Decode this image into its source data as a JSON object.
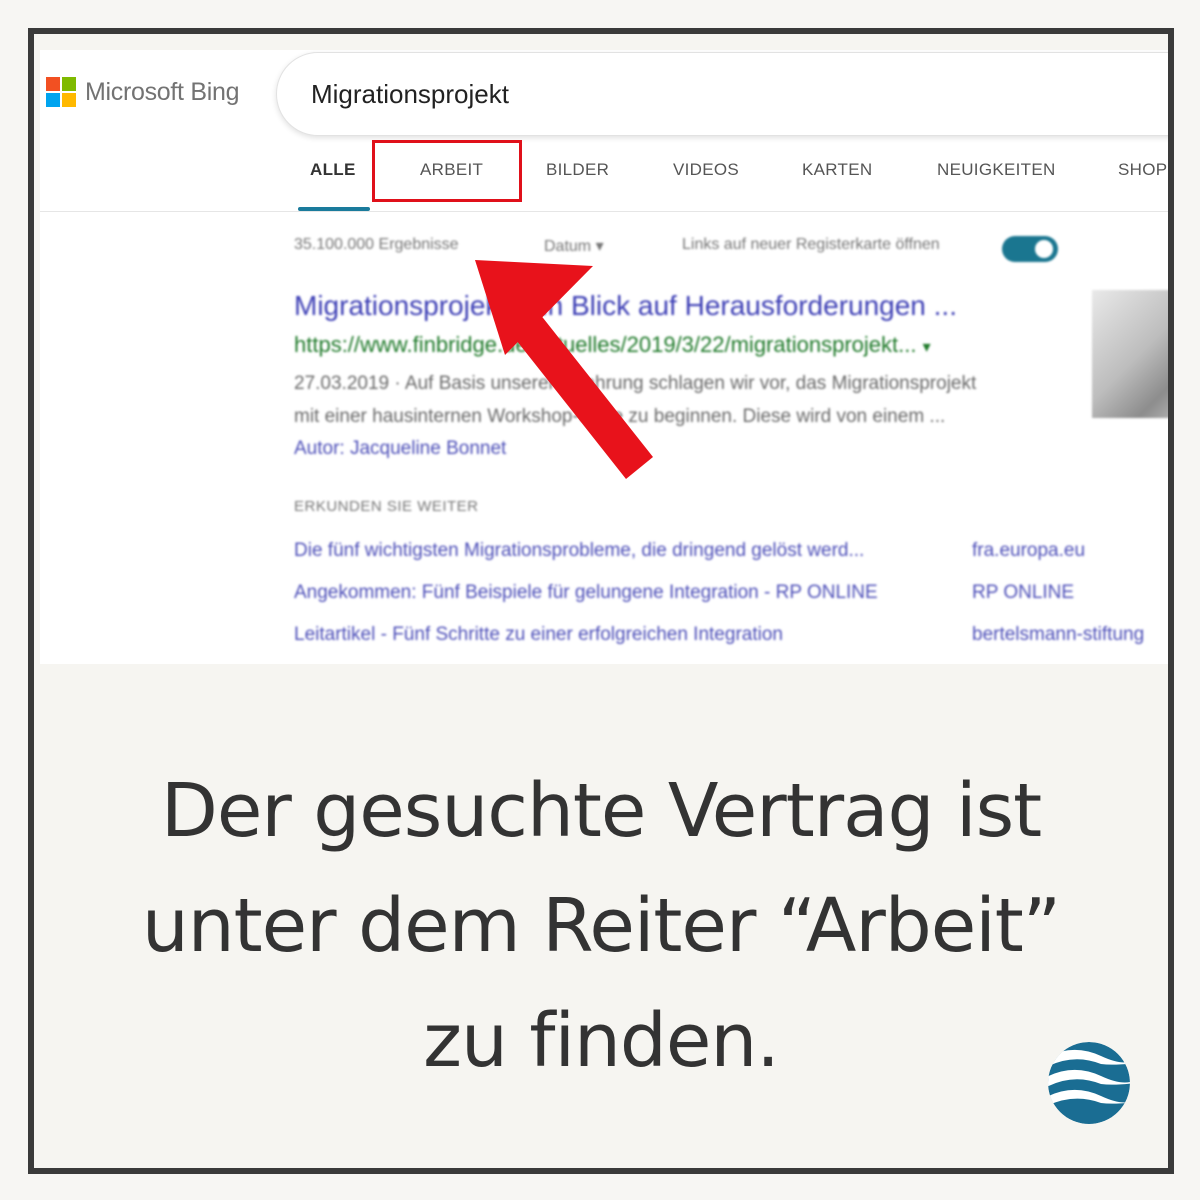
{
  "search": {
    "brand": "Microsoft Bing",
    "query": "Migrationsprojekt"
  },
  "colors": {
    "ms_red": "#f25022",
    "ms_green": "#7fba00",
    "ms_blue": "#00a4ef",
    "ms_yellow": "#ffb900",
    "highlight": "#e0101a",
    "accent": "#1a7b9c",
    "frame": "#3a3a3a"
  },
  "tabs": [
    {
      "label": "ALLE",
      "active": true
    },
    {
      "label": "ARBEIT",
      "highlighted": true
    },
    {
      "label": "BILDER"
    },
    {
      "label": "VIDEOS"
    },
    {
      "label": "KARTEN"
    },
    {
      "label": "NEUIGKEITEN"
    },
    {
      "label": "SHOP"
    }
  ],
  "meta": {
    "result_count": "35.100.000 Ergebnisse",
    "date_filter": "Datum",
    "new_tab_label": "Links auf neuer Registerkarte öffnen",
    "new_tab_enabled": true
  },
  "result": {
    "title": "Migrationsprojekt: Ein Blick auf Herausforderungen ...",
    "url": "https://www.finbridge.de/aktuelles/2019/3/22/migrationsprojekt...",
    "desc_line1": "27.03.2019 · Auf Basis unserer Erfahrung schlagen wir vor, das Migrationsprojekt",
    "desc_line2": "mit einer hausinternen Workshop-Serie zu beginnen. Diese wird von einem ...",
    "author": "Autor: Jacqueline Bonnet"
  },
  "explore": {
    "heading": "ERKUNDEN SIE WEITER",
    "items": [
      {
        "link": "Die fünf wichtigsten Migrationsprobleme, die dringend gelöst werd...",
        "source": "fra.europa.eu"
      },
      {
        "link": "Angekommen: Fünf Beispiele für gelungene Integration - RP ONLINE",
        "source": "RP ONLINE"
      },
      {
        "link": "Leitartikel - Fünf Schritte zu einer erfolgreichen Integration",
        "source": "bertelsmann-stiftung"
      }
    ]
  },
  "caption": {
    "line1": "Der gesuchte Vertrag ist",
    "line2": "unter dem Reiter “Arbeit”",
    "line3": "zu finden."
  }
}
